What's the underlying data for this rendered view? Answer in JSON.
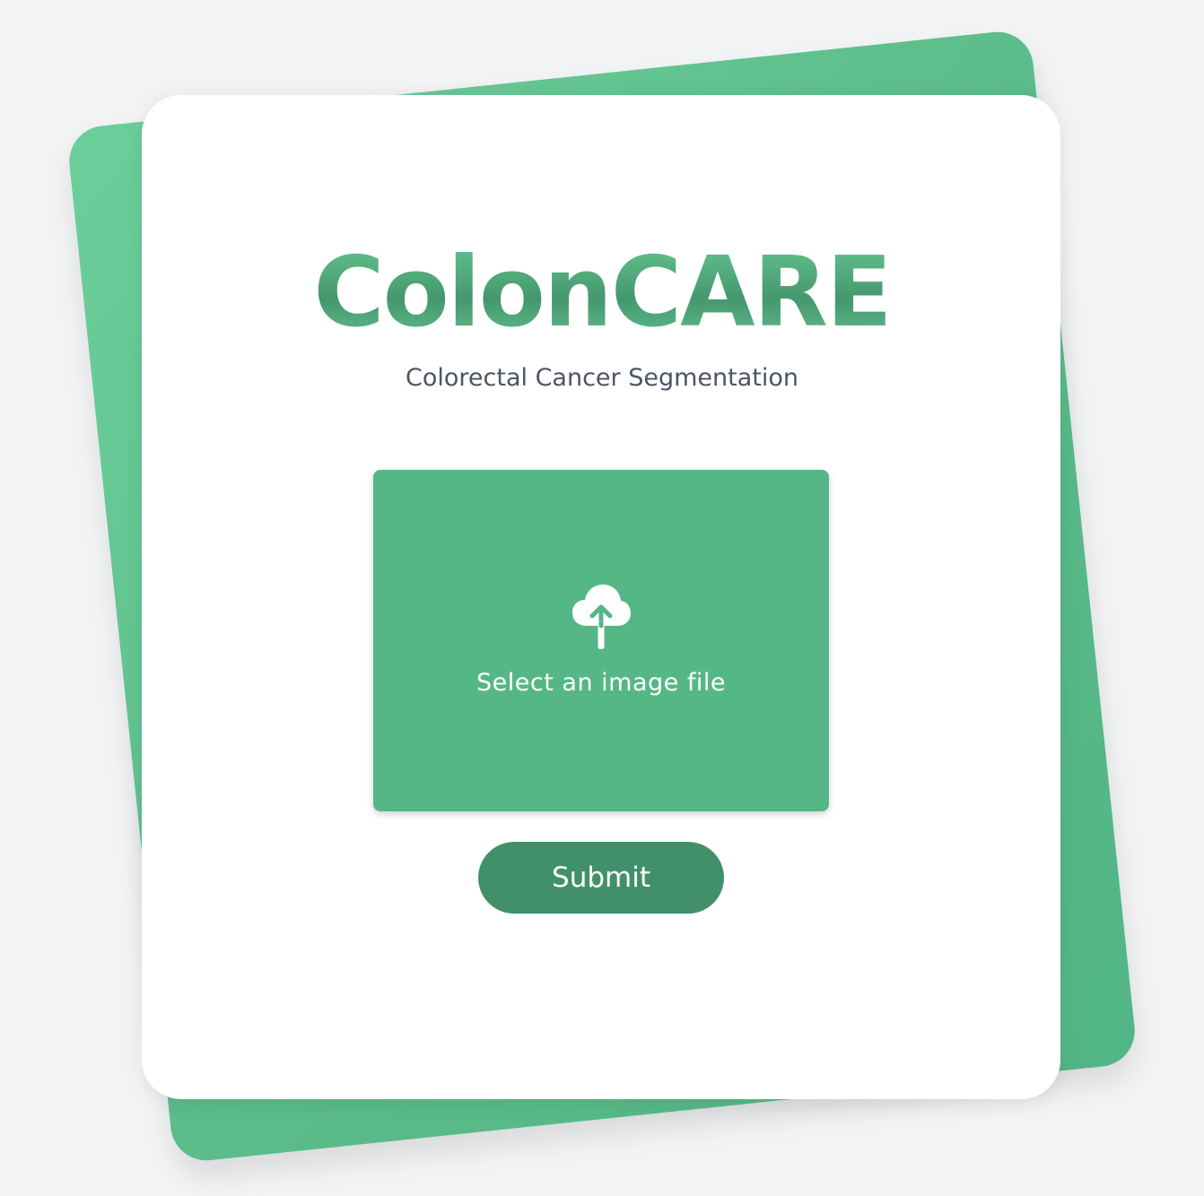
{
  "app": {
    "title": "ColonCARE",
    "subtitle": "Colorectal Cancer Segmentation"
  },
  "upload": {
    "label": "Select an image file",
    "icon": "cloud-upload-icon"
  },
  "form": {
    "submit_label": "Submit"
  },
  "colors": {
    "background": "#f1f3f5",
    "accent_green": "#56b786",
    "button_green": "#42906a",
    "subtitle_gray": "#4b5563"
  }
}
